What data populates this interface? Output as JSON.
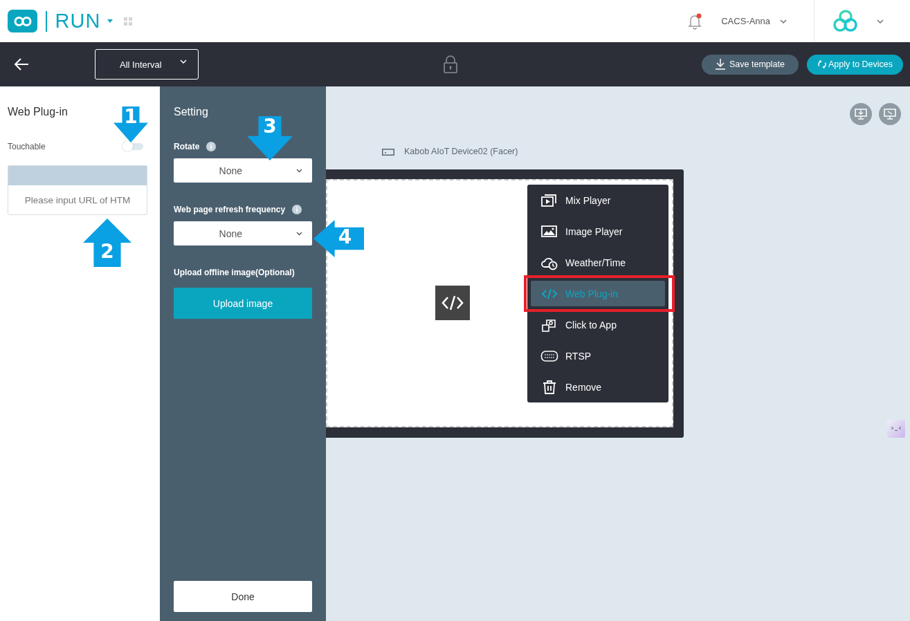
{
  "header": {
    "app_name": "RUN",
    "notification_unread": true,
    "user": "CACS-Anna"
  },
  "toolbar": {
    "interval": "All Interval",
    "buttons": [
      {
        "kind": "save",
        "label": "Save template"
      },
      {
        "kind": "apply",
        "label": "Apply to Devices"
      }
    ]
  },
  "left_panel": {
    "title": "Web Plug-in",
    "touchable": {
      "label": "Touchable",
      "on": false
    },
    "url_field": {
      "placeholder": "Please input URL of HTM"
    }
  },
  "settings": {
    "title": "Setting",
    "rotate": {
      "label": "Rotate",
      "value": "None"
    },
    "refresh": {
      "label": "Web page refresh frequency",
      "value": "None"
    },
    "upload_label": "Upload offline image(Optional)",
    "upload_button": "Upload image",
    "done_button": "Done"
  },
  "canvas": {
    "device_name": "Kabob AIoT Device02 (Facer)",
    "menu": [
      {
        "kind": "mix",
        "label": "Mix Player",
        "selected": false
      },
      {
        "kind": "image",
        "label": "Image Player",
        "selected": false
      },
      {
        "kind": "weather",
        "label": "Weather/Time",
        "selected": false
      },
      {
        "kind": "web",
        "label": "Web Plug-in",
        "selected": true
      },
      {
        "kind": "app",
        "label": "Click to App",
        "selected": false
      },
      {
        "kind": "rtsp",
        "label": "RTSP",
        "selected": false
      },
      {
        "kind": "remove",
        "label": "Remove",
        "selected": false
      }
    ]
  },
  "annotations": {
    "callouts": [
      {
        "number": "1"
      },
      {
        "number": "2"
      },
      {
        "number": "3"
      },
      {
        "number": "4"
      }
    ],
    "highlight_selected": true
  }
}
